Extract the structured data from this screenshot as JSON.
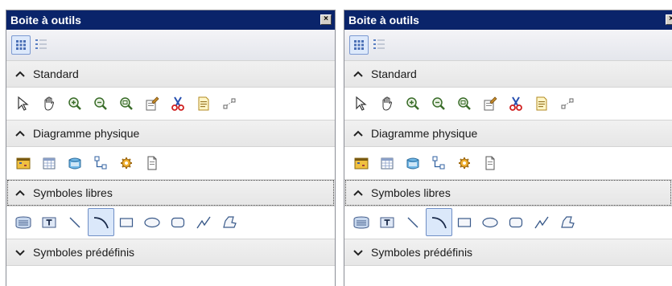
{
  "panels": [
    {
      "title": "Boite à outils",
      "close_label": "×",
      "sections": {
        "standard": "Standard",
        "physique": "Diagramme physique",
        "libres": "Symboles libres",
        "predefinis": "Symboles prédéfinis"
      }
    },
    {
      "title": "Boite à outils",
      "close_label": "×",
      "sections": {
        "standard": "Standard",
        "physique": "Diagramme physique",
        "libres": "Symboles libres",
        "predefinis": "Symboles prédéfinis"
      }
    }
  ],
  "icons": {
    "view": [
      "icons-view-icon",
      "list-view-icon"
    ],
    "standard": [
      "pointer-icon",
      "grabber-hand-icon",
      "zoom-in-icon",
      "zoom-out-icon",
      "open-package-diagram-icon",
      "properties-icon",
      "delete-icon",
      "graphical-synonym-icon",
      "link-icon"
    ],
    "physique": [
      "table-icon",
      "view-icon",
      "reference-icon",
      "join-icon",
      "procedure-icon",
      "file-icon"
    ],
    "libres": [
      "text-box-icon",
      "title-icon",
      "line-icon",
      "arc-icon",
      "rectangle-icon",
      "ellipse-icon",
      "rounded-rectangle-icon",
      "polyline-icon",
      "polygon-icon"
    ]
  },
  "selected_tool": "arc-icon",
  "focused_section": "libres",
  "colors": {
    "titlebar": "#0a246a",
    "selection": "#dbe8fa"
  }
}
